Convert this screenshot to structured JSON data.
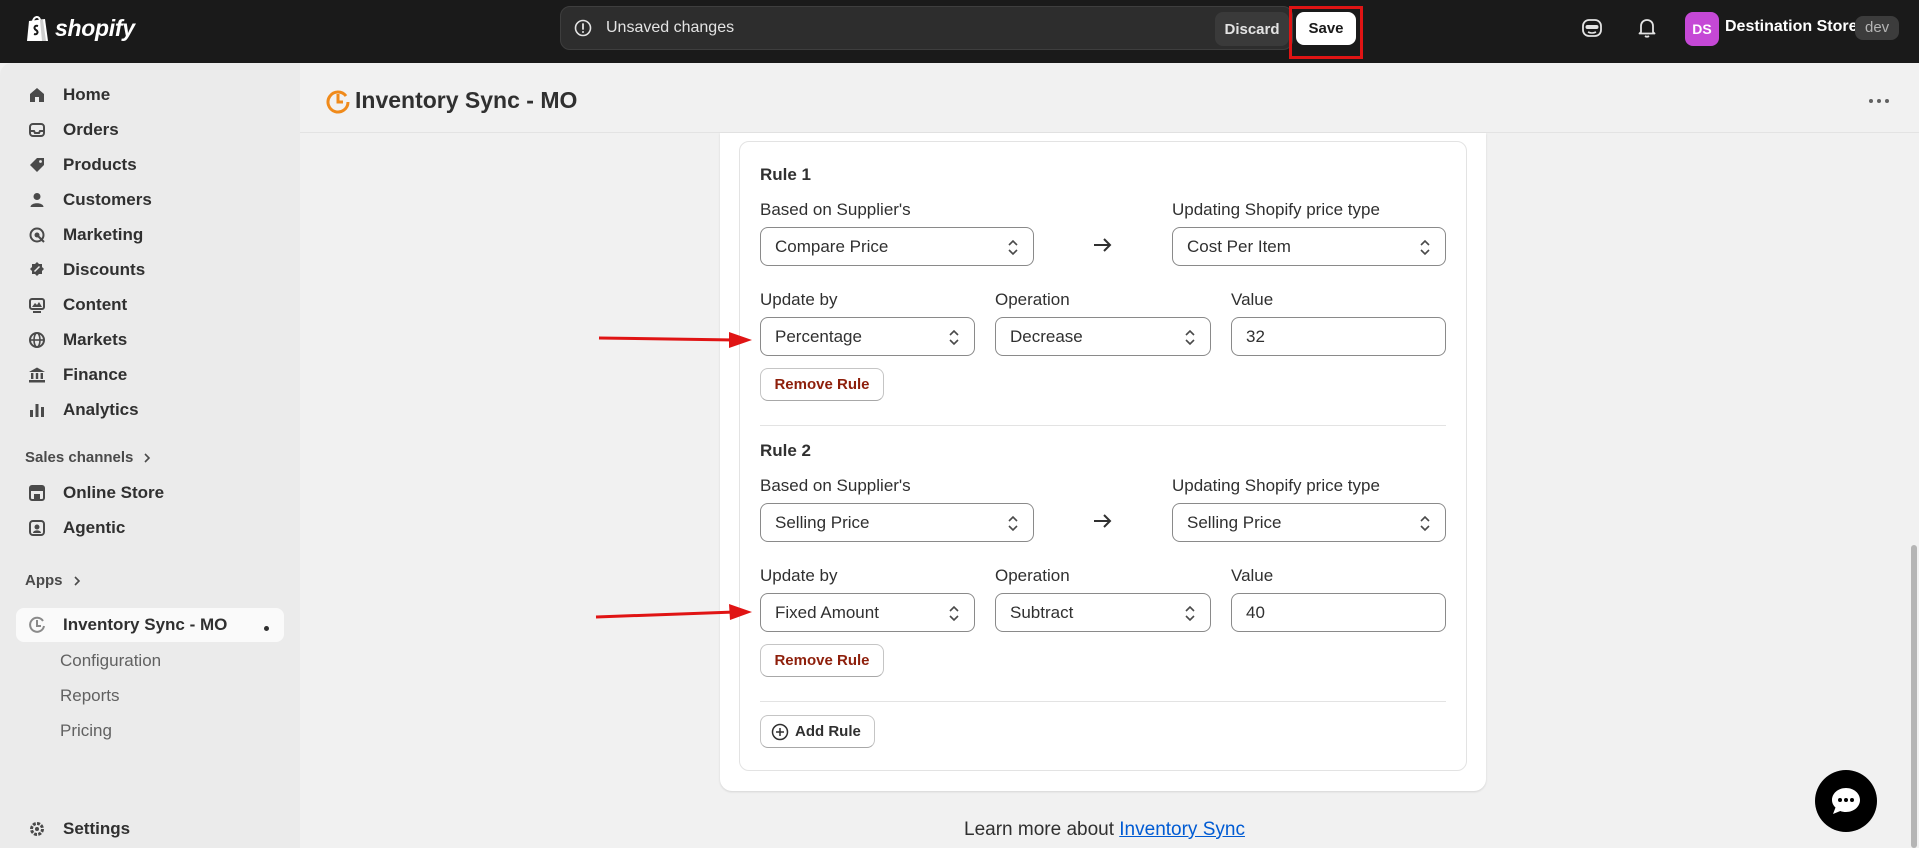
{
  "topbar": {
    "logo_text": "shopify",
    "unsaved_text": "Unsaved changes",
    "discard_label": "Discard",
    "save_label": "Save",
    "avatar_initials": "DS",
    "store_name": "Destination Store",
    "env_badge": "dev"
  },
  "sidebar": {
    "items": [
      {
        "label": "Home",
        "icon": "home-icon"
      },
      {
        "label": "Orders",
        "icon": "orders-icon"
      },
      {
        "label": "Products",
        "icon": "products-icon"
      },
      {
        "label": "Customers",
        "icon": "customers-icon"
      },
      {
        "label": "Marketing",
        "icon": "marketing-icon"
      },
      {
        "label": "Discounts",
        "icon": "discounts-icon"
      },
      {
        "label": "Content",
        "icon": "content-icon"
      },
      {
        "label": "Markets",
        "icon": "markets-icon"
      },
      {
        "label": "Finance",
        "icon": "finance-icon"
      },
      {
        "label": "Analytics",
        "icon": "analytics-icon"
      }
    ],
    "sales_channels_label": "Sales channels",
    "channels": [
      {
        "label": "Online Store",
        "icon": "online-store-icon"
      },
      {
        "label": "Agentic",
        "icon": "agentic-icon"
      }
    ],
    "apps_label": "Apps",
    "active_app": "Inventory Sync - MO",
    "app_subitems": [
      "Configuration",
      "Reports",
      "Pricing"
    ],
    "settings_label": "Settings"
  },
  "page": {
    "title": "Inventory Sync - MO"
  },
  "rules": [
    {
      "title": "Rule 1",
      "based_on_label": "Based on Supplier's",
      "based_on_value": "Compare Price",
      "updating_label": "Updating Shopify price type",
      "updating_value": "Cost Per Item",
      "update_by_label": "Update by",
      "update_by_value": "Percentage",
      "operation_label": "Operation",
      "operation_value": "Decrease",
      "value_label": "Value",
      "value": "32",
      "remove_label": "Remove Rule"
    },
    {
      "title": "Rule 2",
      "based_on_label": "Based on Supplier's",
      "based_on_value": "Selling Price",
      "updating_label": "Updating Shopify price type",
      "updating_value": "Selling Price",
      "update_by_label": "Update by",
      "update_by_value": "Fixed Amount",
      "operation_label": "Operation",
      "operation_value": "Subtract",
      "value_label": "Value",
      "value": "40",
      "remove_label": "Remove Rule"
    }
  ],
  "add_rule_label": "Add Rule",
  "footer": {
    "learn_prefix": "Learn more about",
    "learn_link": "Inventory Sync"
  },
  "colors": {
    "topbar_bg": "#1a1a1a",
    "highlight_red": "#e01414",
    "remove_text": "#8e1f0b",
    "link_blue": "#005bd3",
    "avatar_bg": "#c548d6",
    "app_logo_orange": "#f08a1a"
  }
}
